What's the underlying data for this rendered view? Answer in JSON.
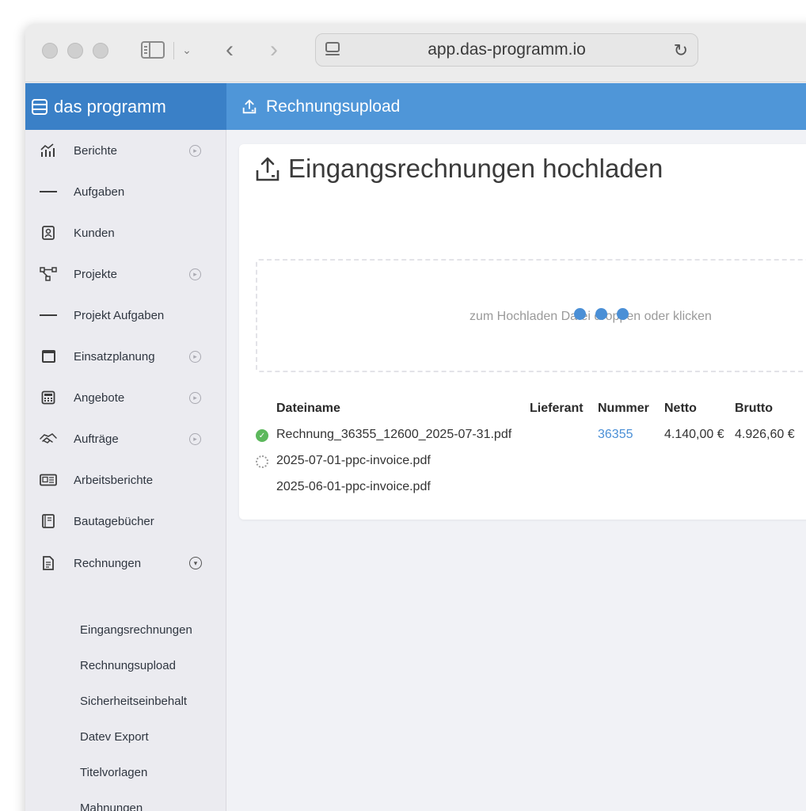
{
  "browser": {
    "url": "app.das-programm.io"
  },
  "app": {
    "brand": "das programm",
    "page_title": "Rechnungsupload"
  },
  "sidebar": {
    "items": [
      {
        "label": "Berichte",
        "icon": "chart-icon",
        "has_arrow": true
      },
      {
        "label": "Aufgaben",
        "icon": "checklist-icon",
        "has_arrow": false
      },
      {
        "label": "Kunden",
        "icon": "contact-icon",
        "has_arrow": false
      },
      {
        "label": "Projekte",
        "icon": "project-tree-icon",
        "has_arrow": true
      },
      {
        "label": "Projekt Aufgaben",
        "icon": "checklist-icon",
        "has_arrow": false
      },
      {
        "label": "Einsatzplanung",
        "icon": "calendar-icon",
        "has_arrow": true
      },
      {
        "label": "Angebote",
        "icon": "calculator-icon",
        "has_arrow": true
      },
      {
        "label": "Aufträge",
        "icon": "handshake-icon",
        "has_arrow": true
      },
      {
        "label": "Arbeitsberichte",
        "icon": "newspaper-icon",
        "has_arrow": false
      },
      {
        "label": "Bautagebücher",
        "icon": "book-icon",
        "has_arrow": false
      },
      {
        "label": "Rechnungen",
        "icon": "invoice-icon",
        "has_arrow": true,
        "expanded": true
      }
    ],
    "subitems": [
      "Eingangsrechnungen",
      "Rechnungsupload",
      "Sicherheitseinbehalt",
      "Datev Export",
      "Titelvorlagen",
      "Mahnungen"
    ]
  },
  "main": {
    "title": "Eingangsrechnungen hochladen",
    "dropzone_text": "zum Hochladen Datei droppen oder klicken",
    "table": {
      "headers": [
        "Dateiname",
        "Lieferant",
        "Nummer",
        "Netto",
        "Brutto"
      ],
      "rows": [
        {
          "status": "done",
          "filename": "Rechnung_36355_12600_2025-07-31.pdf",
          "lieferant": "",
          "nummer": "36355",
          "netto": "4.140,00 €",
          "brutto": "4.926,60 €"
        },
        {
          "status": "loading",
          "filename": "2025-07-01-ppc-invoice.pdf",
          "lieferant": "",
          "nummer": "",
          "netto": "",
          "brutto": ""
        },
        {
          "status": "queued",
          "filename": "2025-06-01-ppc-invoice.pdf",
          "lieferant": "",
          "nummer": "",
          "netto": "",
          "brutto": ""
        }
      ]
    }
  },
  "colors": {
    "brand_bar": "#3a80c7",
    "page_bar": "#4f96d8",
    "link": "#4a8fd6",
    "success": "#5cb85c"
  }
}
